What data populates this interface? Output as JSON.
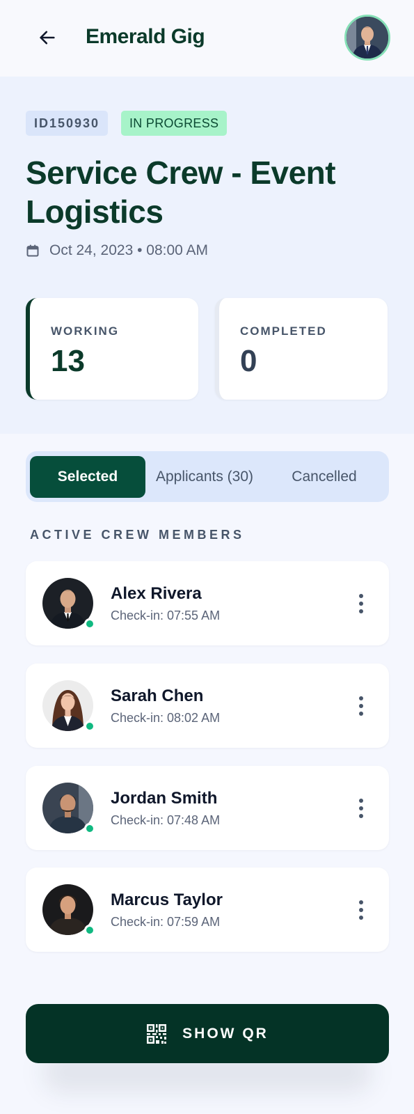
{
  "header": {
    "back_icon": "arrow-left-icon",
    "app_title": "Emerald Gig",
    "profile_avatar": "user-avatar"
  },
  "job": {
    "id": "ID150930",
    "status": "IN PROGRESS",
    "title": "Service Crew - Event Logistics",
    "datetime": "Oct 24, 2023 • 08:00 AM",
    "calendar_icon": "calendar-icon"
  },
  "stats": {
    "working_label": "WORKING",
    "working_value": "13",
    "completed_label": "COMPLETED",
    "completed_value": "0"
  },
  "tabs": [
    {
      "label": "Selected",
      "active": true
    },
    {
      "label": "Applicants (30)",
      "active": false
    },
    {
      "label": "Cancelled",
      "active": false
    }
  ],
  "section_heading": "ACTIVE CREW MEMBERS",
  "members": [
    {
      "name": "Alex Rivera",
      "checkin": "Check-in: 07:55 AM",
      "online": true
    },
    {
      "name": "Sarah Chen",
      "checkin": "Check-in: 08:02 AM",
      "online": true
    },
    {
      "name": "Jordan Smith",
      "checkin": "Check-in: 07:48 AM",
      "online": true
    },
    {
      "name": "Marcus Taylor",
      "checkin": "Check-in: 07:59 AM",
      "online": true
    }
  ],
  "qr_button": {
    "label": "SHOW QR",
    "icon": "qr-code-icon"
  },
  "colors": {
    "brand_dark": "#0b3a2a",
    "tab_active": "#064e3b",
    "status_badge": "#a7f3c9",
    "online": "#10b981",
    "qr_button": "#043326"
  }
}
